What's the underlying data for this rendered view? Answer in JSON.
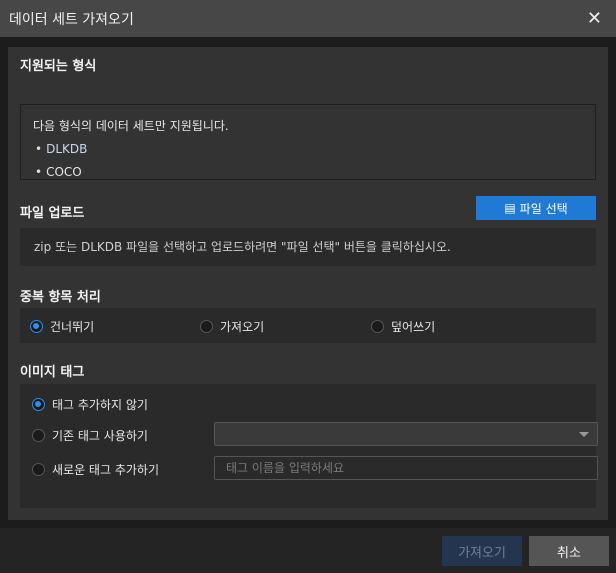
{
  "window": {
    "title": "데이터 세트 가져오기",
    "close_icon": "close-icon"
  },
  "supported": {
    "heading": "지원되는 형식",
    "description": "다음 형식의 데이터 세트만 지원됩니다.",
    "formats": [
      "DLKDB",
      "COCO"
    ]
  },
  "upload": {
    "heading": "파일 업로드",
    "button_label": "파일 선택",
    "info": "zip 또는 DLKDB 파일을 선택하고 업로드하려면 \"파일 선택\" 버튼을 클릭하십시오."
  },
  "duplicates": {
    "heading": "중복 항목 처리",
    "options": [
      "건너뛰기",
      "가져오기",
      "덮어쓰기"
    ],
    "selected": "건너뛰기"
  },
  "image_tag": {
    "heading": "이미지 태그",
    "options": [
      "태그 추가하지 않기",
      "기존 태그 사용하기",
      "새로운 태그 추가하기"
    ],
    "selected": "태그 추가하지 않기",
    "existing_tag_value": "",
    "new_tag_placeholder": "태그 이름을 입력하세요"
  },
  "footer": {
    "import_label": "가져오기",
    "cancel_label": "취소"
  },
  "colors": {
    "accent": "#1f7ad6",
    "import_disabled": "#243550"
  }
}
